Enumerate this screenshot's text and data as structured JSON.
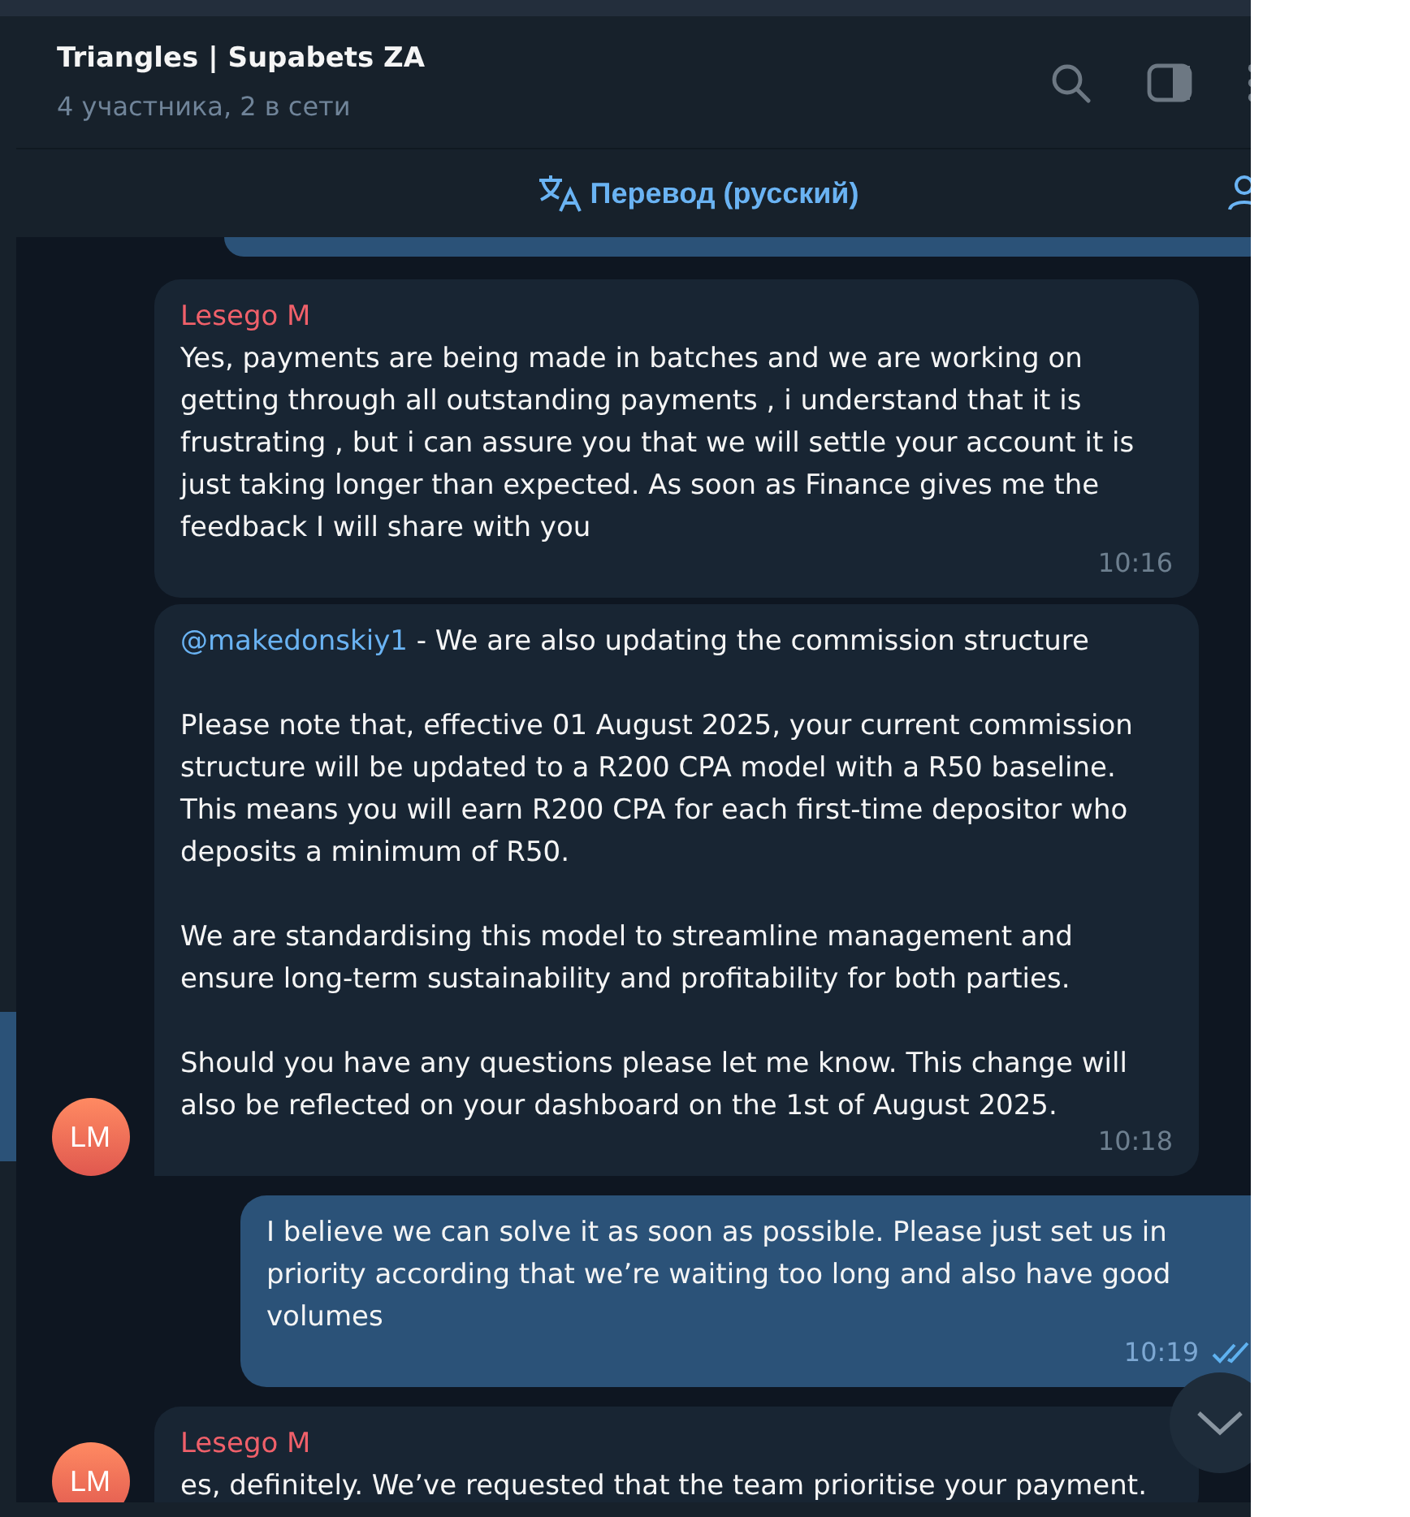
{
  "chat": {
    "title": "Triangles | Supabets ZA",
    "subtitle": "4 участника, 2 в сети"
  },
  "translate_bar": {
    "label": "Перевод (русский)"
  },
  "messages": [
    {
      "kind": "incoming",
      "sender": "Lesego M",
      "paragraphs": [
        "Yes, payments are being made in batches and we are working on getting through all outstanding payments , i understand that it is frustrating , but i can assure you that we will settle your account it is just taking longer than expected. As soon as Finance gives me the feedback I will share with you"
      ],
      "time": "10:16"
    },
    {
      "kind": "incoming",
      "mention": "@makedonskiy1",
      "paragraphs": [
        " - We are also updating the commission structure",
        "Please note that, effective 01 August 2025, your current commission structure will be updated to a R200 CPA model with a R50 baseline. This means you will earn R200 CPA for each first-time depositor who deposits a minimum of R50.",
        "We are standardising this model to streamline management and ensure long-term sustainability and profitability for both parties.",
        "Should you have any questions please let me know. This change will also be reflected on your dashboard on the 1st of August 2025."
      ],
      "time": "10:18",
      "avatar": "LM"
    },
    {
      "kind": "outgoing",
      "paragraphs": [
        "I believe we can solve it as soon as possible. Please just set us in priority according that we’re waiting too long and also have good volumes"
      ],
      "time": "10:19",
      "read": true
    },
    {
      "kind": "incoming",
      "sender": "Lesego M",
      "paragraphs": [
        "es, definitely. We’ve requested that the team prioritise your payment."
      ],
      "avatar": "LM"
    }
  ]
}
